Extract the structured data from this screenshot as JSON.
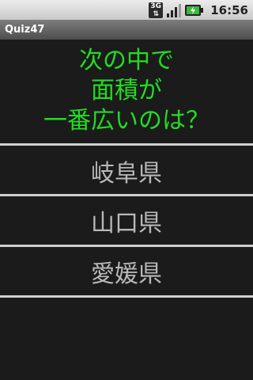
{
  "status_bar": {
    "network_label": "3G",
    "time": "16:56"
  },
  "app": {
    "title": "Quiz47"
  },
  "question": {
    "lines": [
      "次の中で",
      "面積が",
      "一番広いのは？"
    ],
    "color": "#22dd22"
  },
  "answers": [
    {
      "label": "岐阜県"
    },
    {
      "label": "山口県"
    },
    {
      "label": "愛媛県"
    }
  ],
  "colors": {
    "background": "#1b1b1b",
    "divider": "#cfcfcf",
    "answer_text": "#b8b8b8"
  }
}
